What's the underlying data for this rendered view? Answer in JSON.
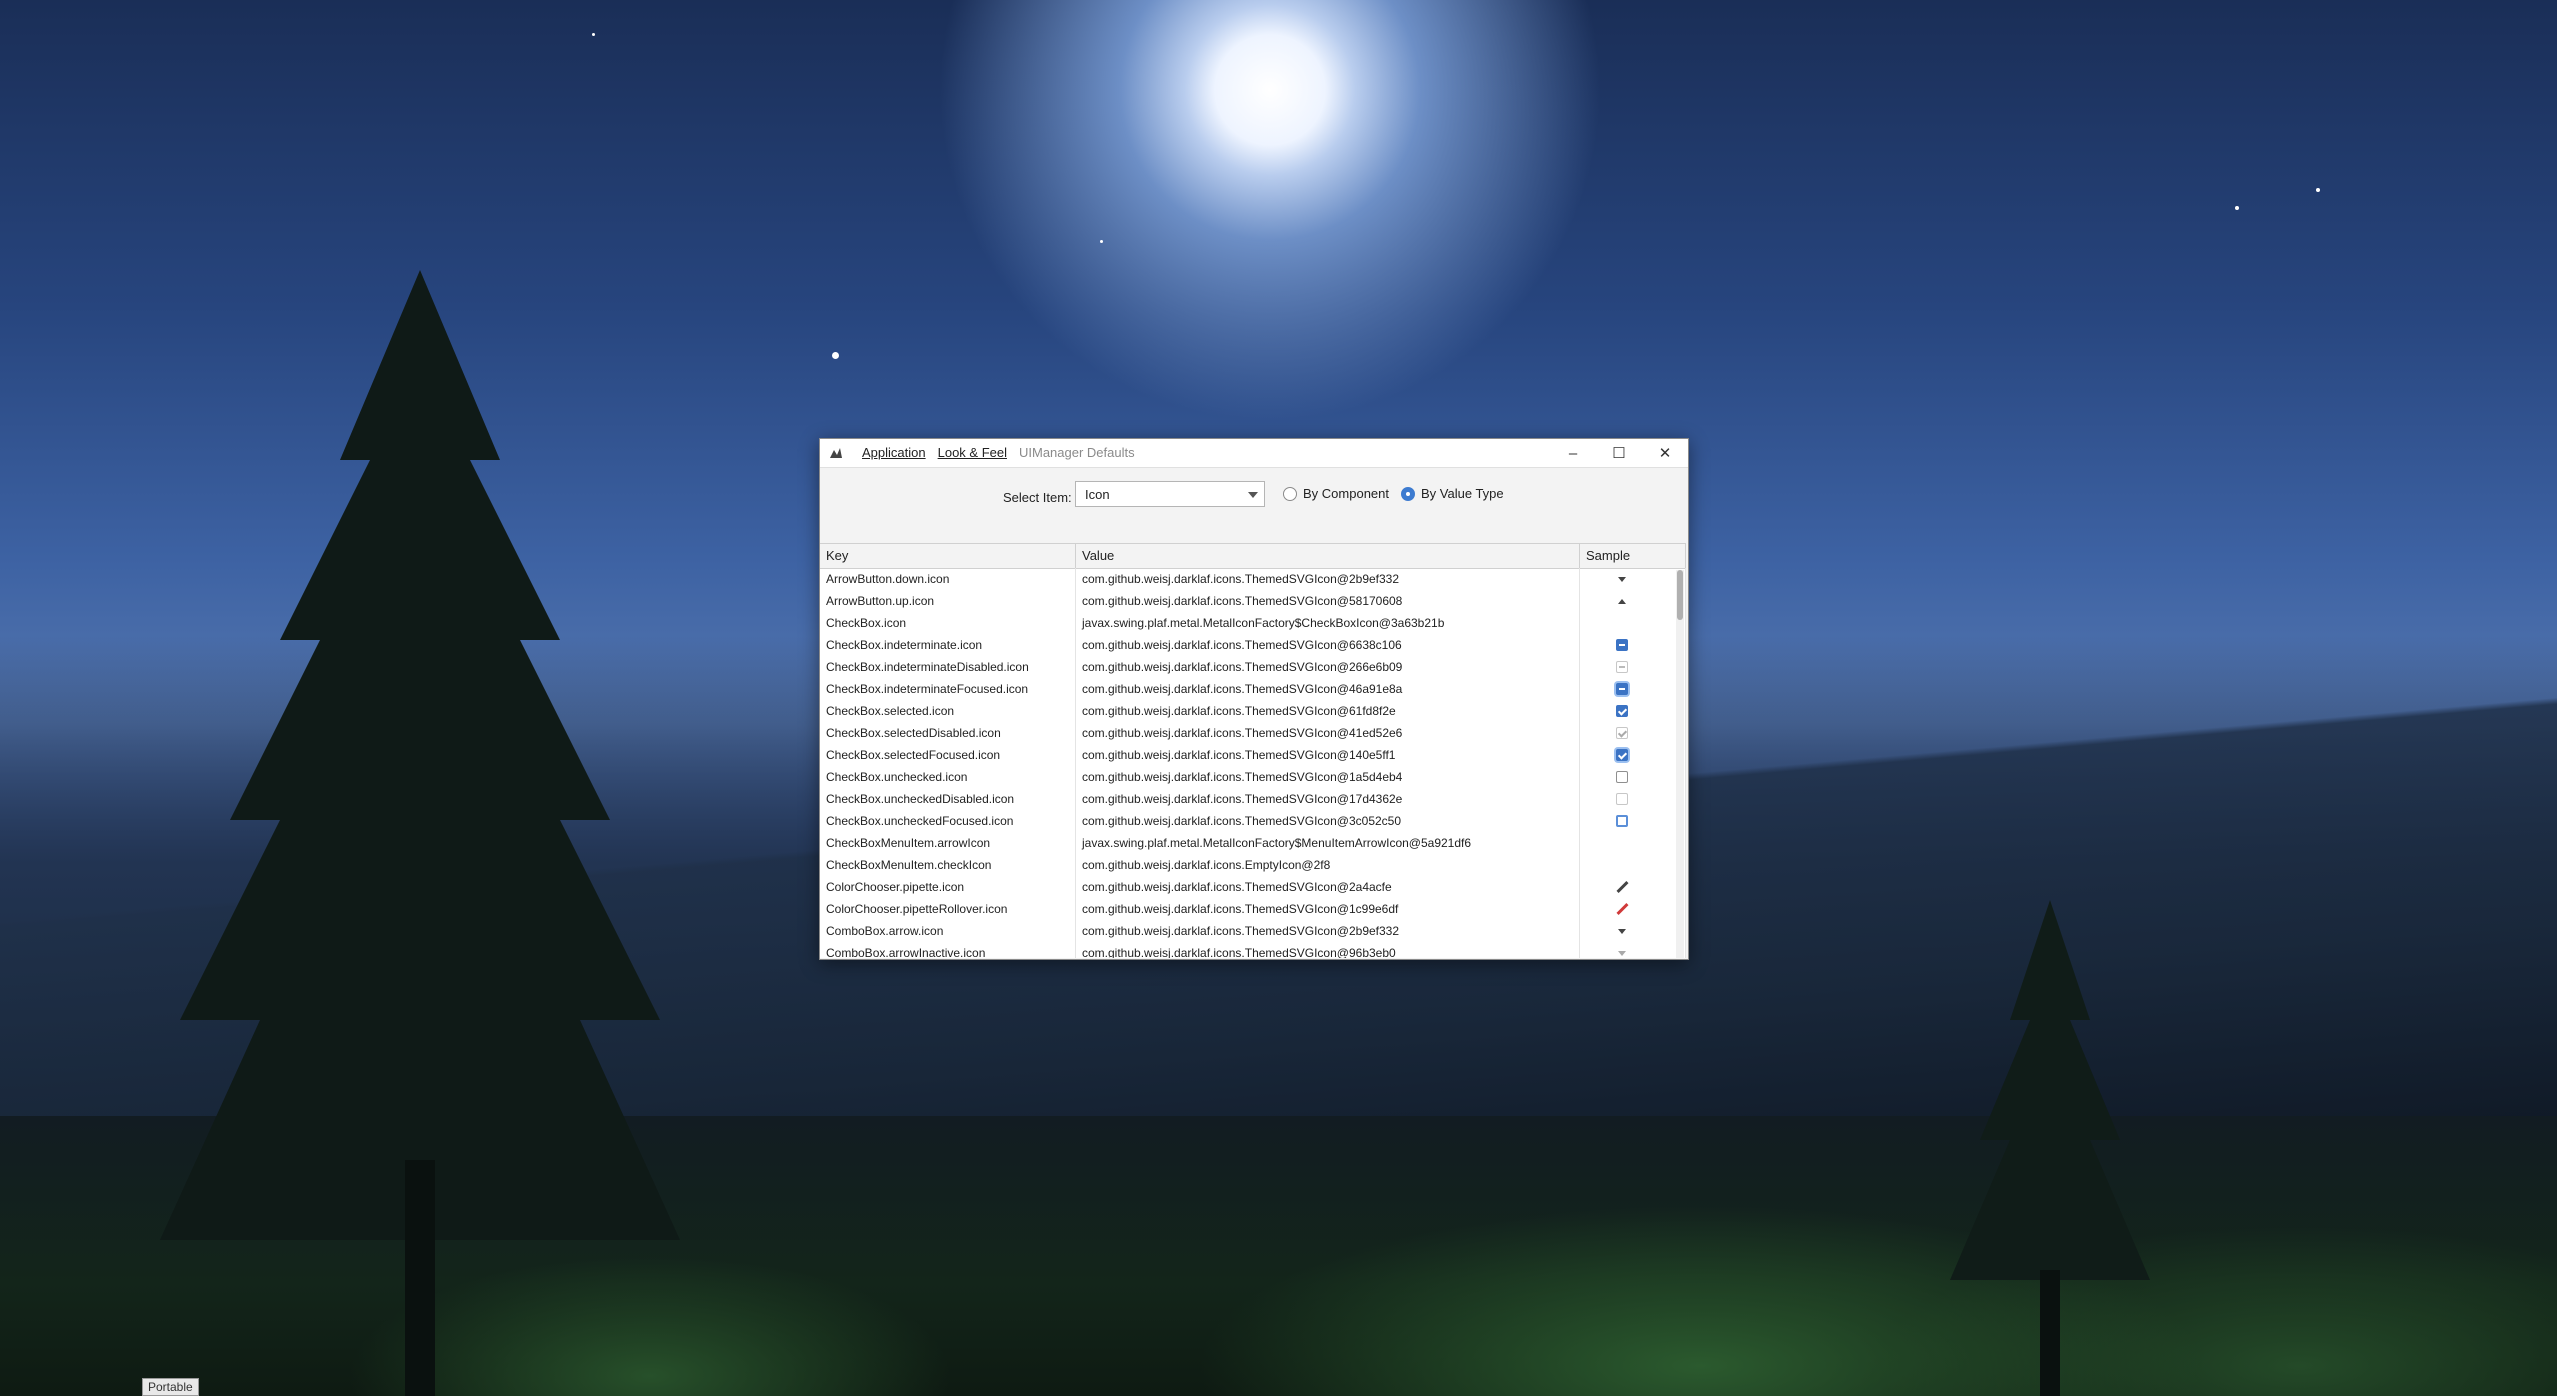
{
  "taskbar": {
    "tag": "Portable"
  },
  "window": {
    "menu": {
      "application": "Application",
      "look_feel": "Look & Feel",
      "title": "UIManager Defaults"
    },
    "controls": {
      "minimize": "–",
      "maximize": "☐",
      "close": "✕"
    },
    "toolbar": {
      "select_label": "Select Item:",
      "select_value": "Icon",
      "radio_by_component": "By Component",
      "radio_by_value_type": "By Value Type",
      "selected_radio": "By Value Type"
    },
    "table": {
      "headers": {
        "key": "Key",
        "value": "Value",
        "sample": "Sample"
      },
      "rows": [
        {
          "key": "ArrowButton.down.icon",
          "value": "com.github.weisj.darklaf.icons.ThemedSVGIcon@2b9ef332",
          "sample": "arrow-down-icon"
        },
        {
          "key": "ArrowButton.up.icon",
          "value": "com.github.weisj.darklaf.icons.ThemedSVGIcon@58170608",
          "sample": "arrow-up-icon"
        },
        {
          "key": "CheckBox.icon",
          "value": "javax.swing.plaf.metal.MetalIconFactory$CheckBoxIcon@3a63b21b",
          "sample": ""
        },
        {
          "key": "CheckBox.indeterminate.icon",
          "value": "com.github.weisj.darklaf.icons.ThemedSVGIcon@6638c106",
          "sample": "checkbox-indeterminate-icon"
        },
        {
          "key": "CheckBox.indeterminateDisabled.icon",
          "value": "com.github.weisj.darklaf.icons.ThemedSVGIcon@266e6b09",
          "sample": "checkbox-indeterminate-disabled-icon"
        },
        {
          "key": "CheckBox.indeterminateFocused.icon",
          "value": "com.github.weisj.darklaf.icons.ThemedSVGIcon@46a91e8a",
          "sample": "checkbox-indeterminate-focused-icon"
        },
        {
          "key": "CheckBox.selected.icon",
          "value": "com.github.weisj.darklaf.icons.ThemedSVGIcon@61fd8f2e",
          "sample": "checkbox-selected-icon"
        },
        {
          "key": "CheckBox.selectedDisabled.icon",
          "value": "com.github.weisj.darklaf.icons.ThemedSVGIcon@41ed52e6",
          "sample": "checkbox-selected-disabled-icon"
        },
        {
          "key": "CheckBox.selectedFocused.icon",
          "value": "com.github.weisj.darklaf.icons.ThemedSVGIcon@140e5ff1",
          "sample": "checkbox-selected-focused-icon"
        },
        {
          "key": "CheckBox.unchecked.icon",
          "value": "com.github.weisj.darklaf.icons.ThemedSVGIcon@1a5d4eb4",
          "sample": "checkbox-unchecked-icon"
        },
        {
          "key": "CheckBox.uncheckedDisabled.icon",
          "value": "com.github.weisj.darklaf.icons.ThemedSVGIcon@17d4362e",
          "sample": "checkbox-unchecked-disabled-icon"
        },
        {
          "key": "CheckBox.uncheckedFocused.icon",
          "value": "com.github.weisj.darklaf.icons.ThemedSVGIcon@3c052c50",
          "sample": "checkbox-unchecked-focused-icon"
        },
        {
          "key": "CheckBoxMenuItem.arrowIcon",
          "value": "javax.swing.plaf.metal.MetalIconFactory$MenuItemArrowIcon@5a921df6",
          "sample": ""
        },
        {
          "key": "CheckBoxMenuItem.checkIcon",
          "value": "com.github.weisj.darklaf.icons.EmptyIcon@2f8",
          "sample": ""
        },
        {
          "key": "ColorChooser.pipette.icon",
          "value": "com.github.weisj.darklaf.icons.ThemedSVGIcon@2a4acfe",
          "sample": "pipette-icon"
        },
        {
          "key": "ColorChooser.pipetteRollover.icon",
          "value": "com.github.weisj.darklaf.icons.ThemedSVGIcon@1c99e6df",
          "sample": "pipette-rollover-icon"
        },
        {
          "key": "ComboBox.arrow.icon",
          "value": "com.github.weisj.darklaf.icons.ThemedSVGIcon@2b9ef332",
          "sample": "combo-arrow-icon"
        },
        {
          "key": "ComboBox.arrowInactive.icon",
          "value": "com.github.weisj.darklaf.icons.ThemedSVGIcon@96b3eb0",
          "sample": "combo-arrow-inactive-icon"
        }
      ]
    }
  }
}
